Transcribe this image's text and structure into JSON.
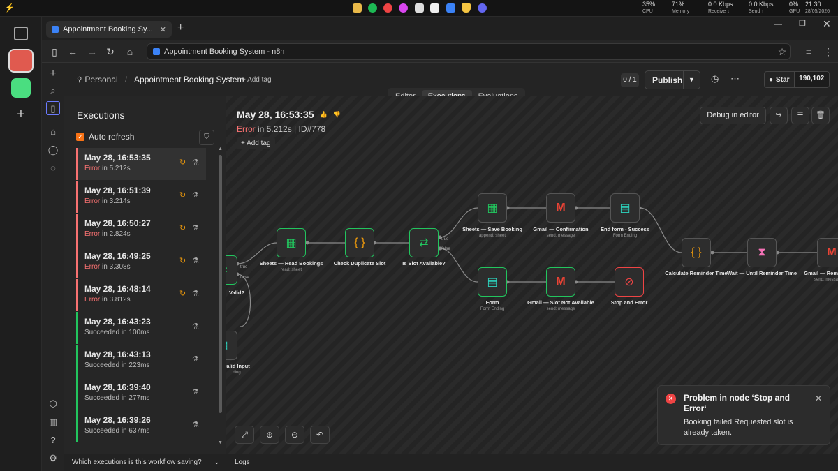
{
  "taskbar": {
    "stats": [
      {
        "value": "35%",
        "label": "CPU"
      },
      {
        "value": "71%",
        "label": "Memory"
      },
      {
        "value": "0.0 Kbps",
        "label": "Receive ↓"
      },
      {
        "value": "0.0 Kbps",
        "label": "Send ↑"
      },
      {
        "value": "0%",
        "label": "GPU"
      }
    ],
    "time": "21:30",
    "date": "28/05/2026"
  },
  "browser": {
    "tab_title": "Appointment Booking Sy...",
    "url": "Appointment Booking System - n8n"
  },
  "header": {
    "project": "Personal",
    "workflow_name": "Appointment Booking System",
    "add_tag": "+ Add tag",
    "counter": "0 / 1",
    "publish": "Publish",
    "star": "Star",
    "stars_count": "190,102"
  },
  "view_tabs": [
    "Editor",
    "Executions",
    "Evaluations"
  ],
  "executions": {
    "title": "Executions",
    "auto_refresh": "Auto refresh",
    "items": [
      {
        "time": "May 28, 16:53:35",
        "status": "Error",
        "duration": " in 5.212s"
      },
      {
        "time": "May 28, 16:51:39",
        "status": "Error",
        "duration": " in 3.214s"
      },
      {
        "time": "May 28, 16:50:27",
        "status": "Error",
        "duration": " in 2.824s"
      },
      {
        "time": "May 28, 16:49:25",
        "status": "Error",
        "duration": " in 3.308s"
      },
      {
        "time": "May 28, 16:48:14",
        "status": "Error",
        "duration": " in 3.812s"
      },
      {
        "time": "May 28, 16:43:23",
        "status": "Succeeded in 100ms",
        "duration": ""
      },
      {
        "time": "May 28, 16:43:13",
        "status": "Succeeded in 223ms",
        "duration": ""
      },
      {
        "time": "May 28, 16:39:40",
        "status": "Succeeded in 277ms",
        "duration": ""
      },
      {
        "time": "May 28, 16:39:26",
        "status": "Succeeded in 637ms",
        "duration": ""
      }
    ],
    "footer": "Which executions is this workflow saving?"
  },
  "detail": {
    "title": "May 28, 16:53:35",
    "status": "Error",
    "meta": " in 5.212s | ID#778",
    "add_tag": "+ Add tag",
    "debug": "Debug in editor"
  },
  "nodes": {
    "valid_q": "Valid?",
    "true_lbl": "true",
    "false_lbl": "false",
    "invalid_input": "valid Input",
    "invalid_input_sub": "ding",
    "read_bookings": "Sheets — Read Bookings",
    "read_bookings_sub": "read: sheet",
    "check_dup": "Check Duplicate Slot",
    "slot_available": "Is Slot Available?",
    "save_booking": "Sheets — Save Booking",
    "save_booking_sub": "append: sheet",
    "gmail_confirm": "Gmail — Confirmation",
    "gmail_confirm_sub": "send: message",
    "end_success": "End form - Success",
    "end_success_sub": "Form Ending",
    "form": "Form",
    "form_sub": "Form Ending",
    "gmail_not_avail": "Gmail — Slot Not Available",
    "gmail_not_avail_sub": "send: message",
    "stop_error": "Stop and Error",
    "calc_reminder": "Calculate Reminder Time",
    "wait_reminder": "Wait — Until Reminder Time",
    "gmail_rem": "Gmail — Rem",
    "gmail_rem_sub": "send: messa"
  },
  "toast": {
    "title": "Problem in node ‘Stop and Error‘",
    "message": "Booking failed Requested slot is already taken."
  },
  "logs": "Logs",
  "colors": {
    "error": "#f87171",
    "success": "#22c55e",
    "accent": "#ff6d5a",
    "toast_icon": "#ef4444"
  }
}
